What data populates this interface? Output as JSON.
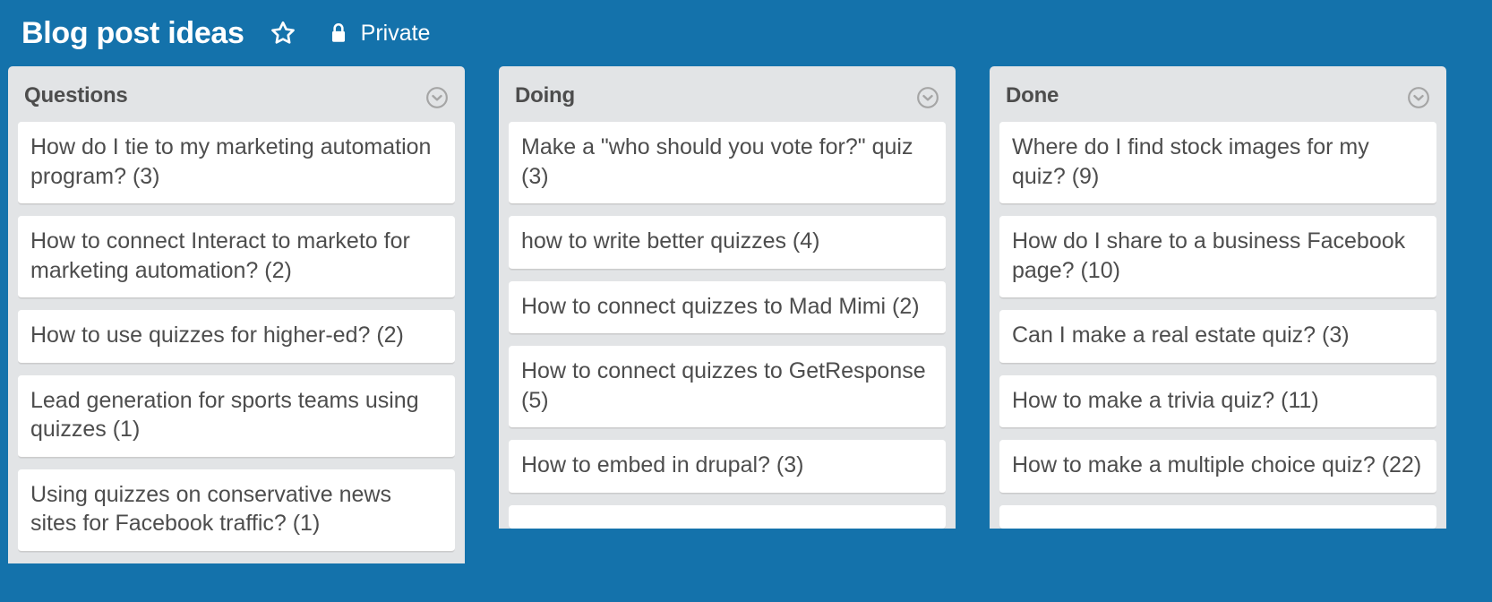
{
  "header": {
    "board_title": "Blog post ideas",
    "star_icon": "star-outline-icon",
    "lock_icon": "lock-icon",
    "visibility": "Private"
  },
  "colors": {
    "board_background": "#1472ab",
    "list_background": "#e2e4e6",
    "card_background": "#ffffff",
    "text": "#4d4d4d",
    "header_text": "#ffffff"
  },
  "lists": [
    {
      "title": "Questions",
      "menu_icon": "chevron-down-circle-icon",
      "cards": [
        {
          "text": "How do I tie to my marketing automation program? (3)"
        },
        {
          "text": "How to connect Interact to marketo for marketing automation? (2)"
        },
        {
          "text": "How to use quizzes for higher-ed? (2)"
        },
        {
          "text": "Lead generation for sports teams using quizzes (1)"
        },
        {
          "text": "Using quizzes on conservative news sites for Facebook traffic? (1)"
        }
      ]
    },
    {
      "title": "Doing",
      "menu_icon": "chevron-down-circle-icon",
      "cards": [
        {
          "text": "Make a \"who should you vote for?\" quiz (3)"
        },
        {
          "text": "how to write better quizzes (4)"
        },
        {
          "text": "How to connect quizzes to Mad Mimi (2)"
        },
        {
          "text": "How to connect quizzes to GetResponse (5)"
        },
        {
          "text": "How to embed in drupal? (3)"
        },
        {
          "text": ""
        }
      ]
    },
    {
      "title": "Done",
      "menu_icon": "chevron-down-circle-icon",
      "cards": [
        {
          "text": "Where do I find stock images for my quiz? (9)"
        },
        {
          "text": "How do I share to a business Facebook page? (10)"
        },
        {
          "text": "Can I make a real estate quiz? (3)"
        },
        {
          "text": "How to make a trivia quiz? (11)"
        },
        {
          "text": "How to make a multiple choice quiz? (22)"
        },
        {
          "text": ""
        }
      ]
    }
  ]
}
